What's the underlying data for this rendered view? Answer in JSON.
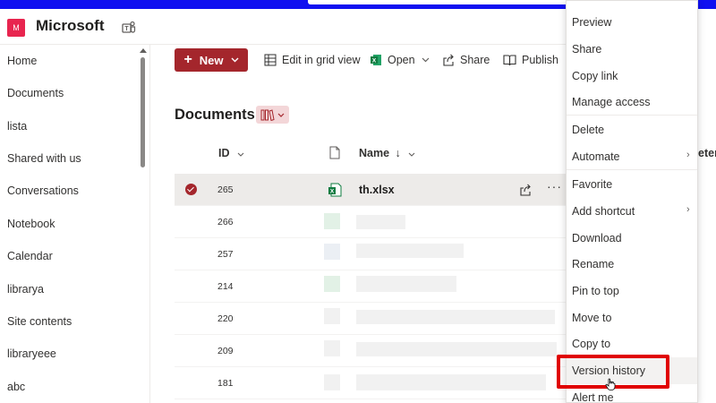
{
  "site": {
    "logo_letter": "M",
    "title": "Microsoft"
  },
  "nav": {
    "items": [
      "Home",
      "Documents",
      "lista",
      "Shared with us",
      "Conversations",
      "Notebook",
      "Calendar",
      "librarya",
      "Site contents",
      "libraryeee",
      "abc"
    ]
  },
  "toolbar": {
    "new_label": "New",
    "edit_grid_label": "Edit in grid view",
    "open_label": "Open",
    "share_label": "Share",
    "publish_label": "Publish"
  },
  "library": {
    "title": "Documents",
    "columns": {
      "id": "ID",
      "name": "Name",
      "overflow_fragment": "eter"
    },
    "rows": [
      {
        "id": "265",
        "name": "th.xlsx",
        "selected": true
      },
      {
        "id": "266",
        "name": ""
      },
      {
        "id": "257",
        "name": ""
      },
      {
        "id": "214",
        "name": ""
      },
      {
        "id": "220",
        "name": ""
      },
      {
        "id": "209",
        "name": ""
      },
      {
        "id": "181",
        "name": ""
      }
    ]
  },
  "context_menu": {
    "items": [
      "Preview",
      "Share",
      "Copy link",
      "Manage access",
      "Delete",
      "Automate",
      "Favorite",
      "Add shortcut",
      "Download",
      "Rename",
      "Pin to top",
      "Move to",
      "Copy to",
      "Version history",
      "Alert me"
    ]
  },
  "colors": {
    "accent": "#a4262c",
    "topbar": "#1010f0",
    "highlight": "#e00000",
    "site_logo": "#e8254f"
  },
  "icons": {
    "teams": "teams-icon",
    "grid": "grid-icon",
    "excel": "excel-icon",
    "share": "share-icon",
    "publish": "publish-icon",
    "file": "file-icon",
    "view": "library-view-icon"
  }
}
